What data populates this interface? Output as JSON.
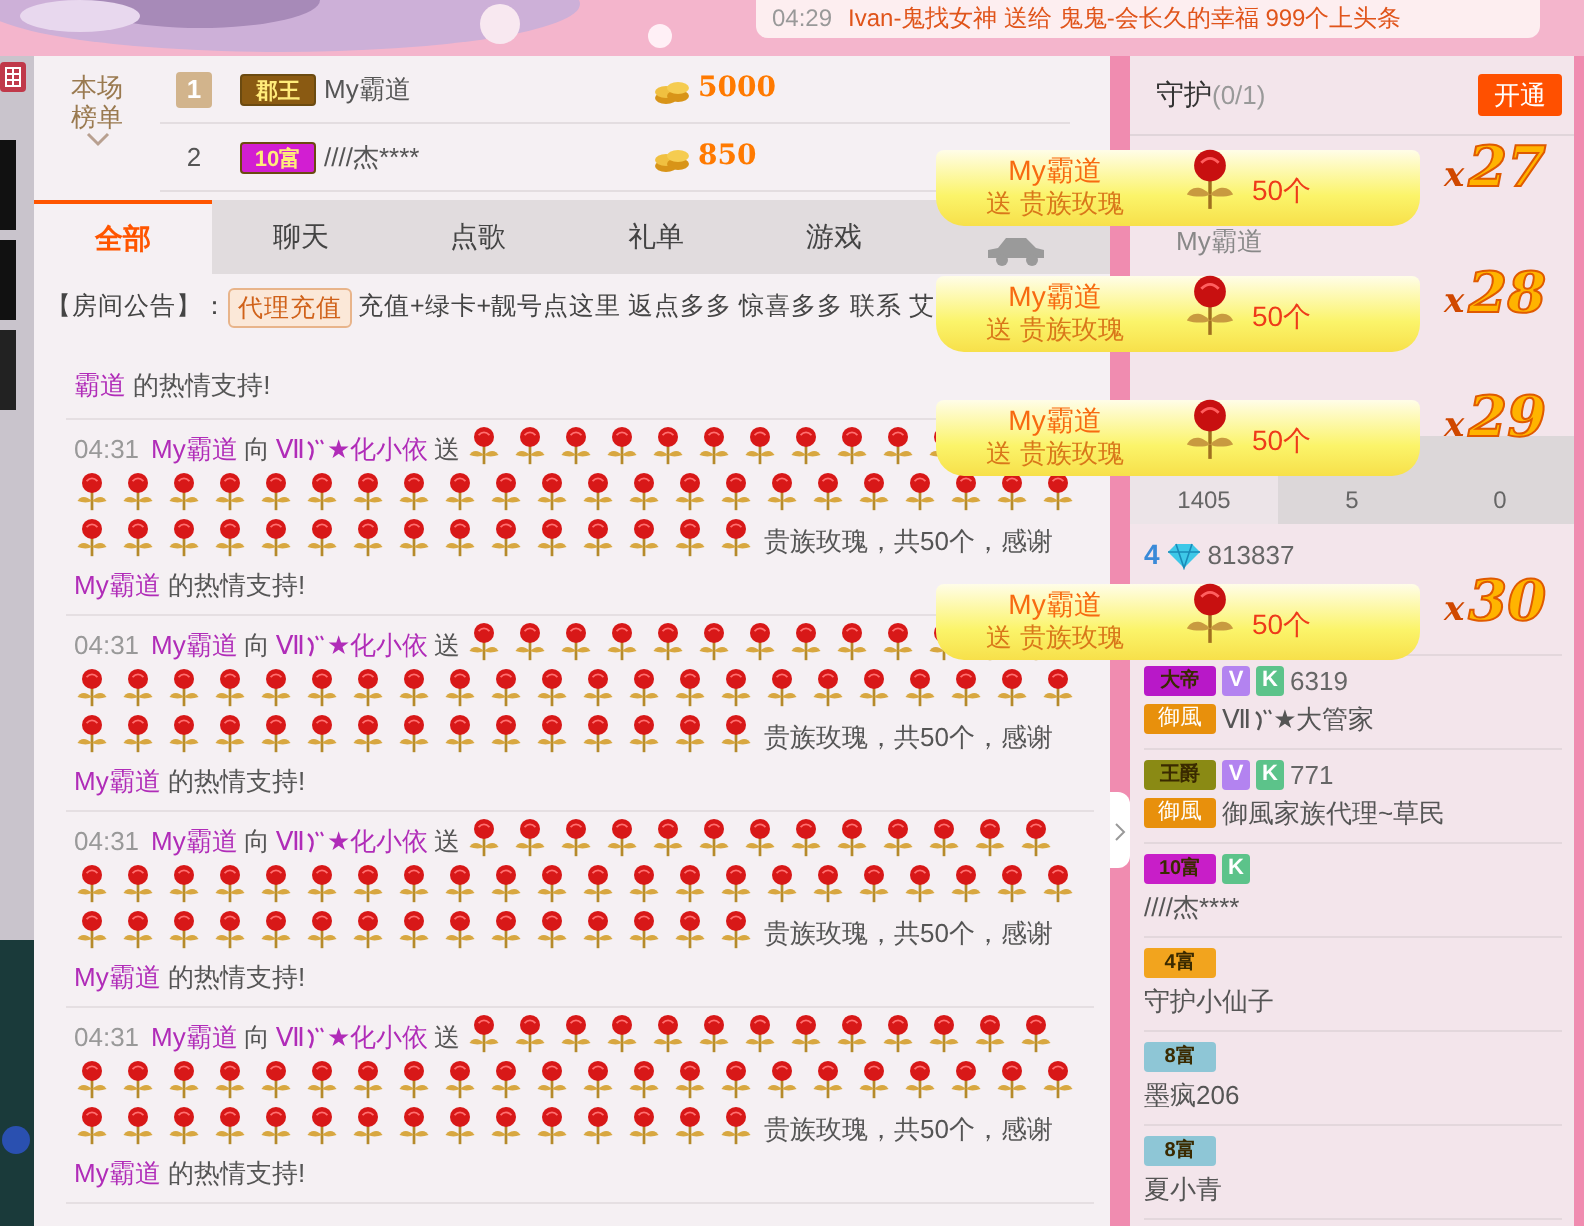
{
  "notification": {
    "time": "04:29",
    "text": "Ivan-鬼找女神 送给 鬼鬼-会长久的幸福 999个上头条"
  },
  "ranking": {
    "title": "本场榜单",
    "rows": [
      {
        "rank": "1",
        "kind": "medal",
        "badge": {
          "text": "郡王",
          "color": "#8a5a12"
        },
        "name": "My霸道",
        "coins": "5000"
      },
      {
        "rank": "2",
        "kind": "plain",
        "badge": {
          "text": "10富",
          "color": "#d21ed2"
        },
        "name": "////杰****",
        "coins": "850"
      }
    ]
  },
  "tabs": [
    {
      "kind": "text",
      "label": "全部",
      "selected": true
    },
    {
      "kind": "text",
      "label": "聊天",
      "selected": false
    },
    {
      "kind": "text",
      "label": "点歌",
      "selected": false
    },
    {
      "kind": "text",
      "label": "礼单",
      "selected": false
    },
    {
      "kind": "text",
      "label": "游戏",
      "selected": false
    },
    {
      "kind": "car",
      "selected": false
    }
  ],
  "announcement": {
    "label": "【房间公告】：",
    "button": "代理充值",
    "text": "充值+绿卡+靓号点这里 返点多多 惊喜多多 联系 艾"
  },
  "messages": [
    {
      "kind": "tail",
      "thanks_name": "霸道",
      "suffix": "的热情支持!"
    },
    {
      "kind": "gift",
      "time": "04:31",
      "from": "My霸道",
      "verb": "向",
      "to": "Ⅶ",
      "to_tail": "★化小依",
      "action": "送",
      "gift_text": "贵族玫瑰，共50个，感谢",
      "thanks_name": "My霸道",
      "suffix": "的热情支持!"
    },
    {
      "kind": "gift",
      "time": "04:31",
      "from": "My霸道",
      "verb": "向",
      "to": "Ⅶ",
      "to_tail": "★化小依",
      "action": "送",
      "gift_text": "贵族玫瑰，共50个，感谢",
      "thanks_name": "My霸道",
      "suffix": "的热情支持!"
    },
    {
      "kind": "gift",
      "time": "04:31",
      "from": "My霸道",
      "verb": "向",
      "to": "Ⅶ",
      "to_tail": "★化小依",
      "action": "送",
      "gift_text": "贵族玫瑰，共50个，感谢",
      "thanks_name": "My霸道",
      "suffix": "的热情支持!"
    },
    {
      "kind": "gift",
      "time": "04:31",
      "from": "My霸道",
      "verb": "向",
      "to": "Ⅶ",
      "to_tail": "★化小依",
      "action": "送",
      "gift_text": "贵族玫瑰，共50个，感谢",
      "thanks_name": "My霸道",
      "suffix": "的热情支持!"
    }
  ],
  "guard": {
    "title": "守护",
    "count": "(0/1)",
    "button": "开通",
    "member": "My霸道"
  },
  "stats": [
    {
      "value": "1405",
      "selected": true
    },
    {
      "value": "5",
      "selected": false
    },
    {
      "value": "0",
      "selected": false
    }
  ],
  "users": [
    {
      "badge": {
        "kind": "diamond",
        "text": "4"
      },
      "id": "813837"
    },
    {
      "badge": {
        "kind": "level",
        "text": "大帝",
        "color": "#b818c8"
      },
      "tags": [
        {
          "text": "V",
          "color": "#b383f0"
        },
        {
          "text": "K",
          "color": "#5cc38a"
        }
      ],
      "id": "6319",
      "family": "御風",
      "name": "Ⅶ",
      "name_tail": "★大管家"
    },
    {
      "badge": {
        "kind": "level",
        "text": "王爵",
        "color": "#8a8a14"
      },
      "tags": [
        {
          "text": "V",
          "color": "#b383f0"
        },
        {
          "text": "K",
          "color": "#5cc38a"
        }
      ],
      "id": "771",
      "family": "御風",
      "name": "御風家族代理~草民"
    },
    {
      "badge": {
        "kind": "level",
        "text": "10富",
        "color": "#c81ec8"
      },
      "tags": [
        {
          "text": "K",
          "color": "#5cc38a"
        }
      ],
      "name": "////杰****"
    },
    {
      "badge": {
        "kind": "level",
        "text": "4富",
        "color": "#f2a41e"
      },
      "name": "守护小仙子"
    },
    {
      "badge": {
        "kind": "level",
        "text": "8富",
        "color": "#8ec6d6"
      },
      "name": "墨疯206"
    },
    {
      "badge": {
        "kind": "level",
        "text": "8富",
        "color": "#8ec6d6"
      },
      "name": "夏小青"
    }
  ],
  "banners": [
    {
      "name": "My霸道",
      "action": "送 贵族玫瑰",
      "count": "50个",
      "combo_sign": "x",
      "combo": "27"
    },
    {
      "name": "My霸道",
      "action": "送 贵族玫瑰",
      "count": "50个",
      "combo_sign": "x",
      "combo": "28"
    },
    {
      "name": "My霸道",
      "action": "送 贵族玫瑰",
      "count": "50个",
      "combo_sign": "x",
      "combo": "29"
    },
    {
      "name": "My霸道",
      "action": "送 贵族玫瑰",
      "count": "50个",
      "combo_sign": "x",
      "combo": "30"
    }
  ]
}
